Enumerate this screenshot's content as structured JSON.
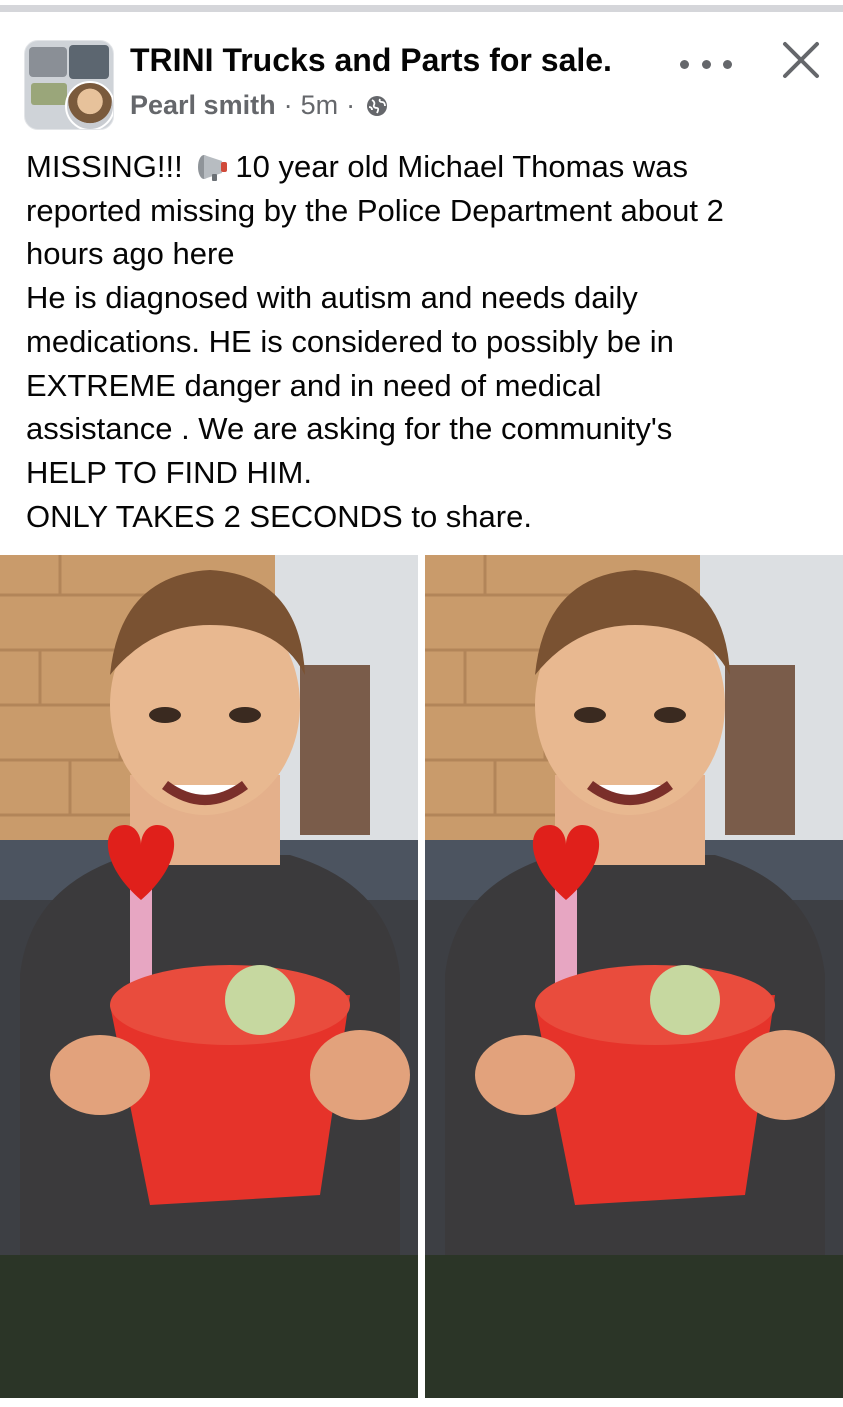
{
  "post": {
    "group_name": "TRINI Trucks and Parts for sale.",
    "author": "Pearl smith",
    "time": "5m",
    "sep": "·",
    "privacy_icon": "globe-icon",
    "lines": {
      "l1a": "MISSING!!!",
      "l1b": "10 year old Michael Thomas was",
      "l2": "reported missing by the Police Department about 2",
      "l3": "hours ago here",
      "l4": "He is diagnosed with autism and needs daily",
      "l5": "medications. HE is considered to possibly be in",
      "l6": "EXTREME danger and in need of medical",
      "l7": "assistance . We are asking for the community's",
      "l8": "HELP TO FIND HIM.",
      "l9": "ONLY TAKES 2 SECONDS to share."
    }
  },
  "icons": {
    "more": "more-icon",
    "close": "close-icon",
    "megaphone": "megaphone-icon"
  },
  "colors": {
    "text": "#050505",
    "meta": "#65676b",
    "divider": "#d5d6da"
  },
  "photos": [
    {
      "name": "missing-boy-photo-left"
    },
    {
      "name": "missing-boy-photo-right"
    }
  ]
}
